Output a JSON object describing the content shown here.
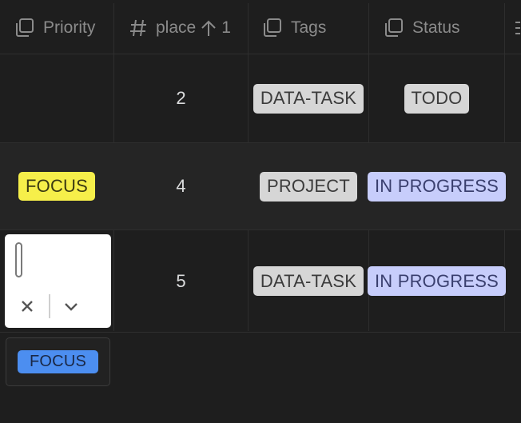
{
  "columns": [
    {
      "label": "Priority",
      "icon": "tag-list-icon"
    },
    {
      "label": "place",
      "icon": "hash-icon",
      "sort_rank": "1",
      "sort_direction": "ascending"
    },
    {
      "label": "Tags",
      "icon": "tag-list-icon"
    },
    {
      "label": "Status",
      "icon": "tag-list-icon"
    }
  ],
  "rows": [
    {
      "priority": "",
      "place": "2",
      "tags": "DATA-TASK",
      "status": "TODO"
    },
    {
      "priority": "FOCUS",
      "place": "4",
      "tags": "PROJECT",
      "status": "IN PROGRESS"
    },
    {
      "priority": "",
      "place": "5",
      "tags": "DATA-TASK",
      "status": "IN PROGRESS"
    }
  ],
  "editor": {
    "current_value": "",
    "dropdown_options": [
      "FOCUS"
    ]
  },
  "colors": {
    "background": "#1e1e1e",
    "gray_tag": "#d6d6d6",
    "focus_tag": "#f6ef4a",
    "status_in_progress": "#c7cdfb",
    "option_highlight": "#4c8ef0"
  }
}
